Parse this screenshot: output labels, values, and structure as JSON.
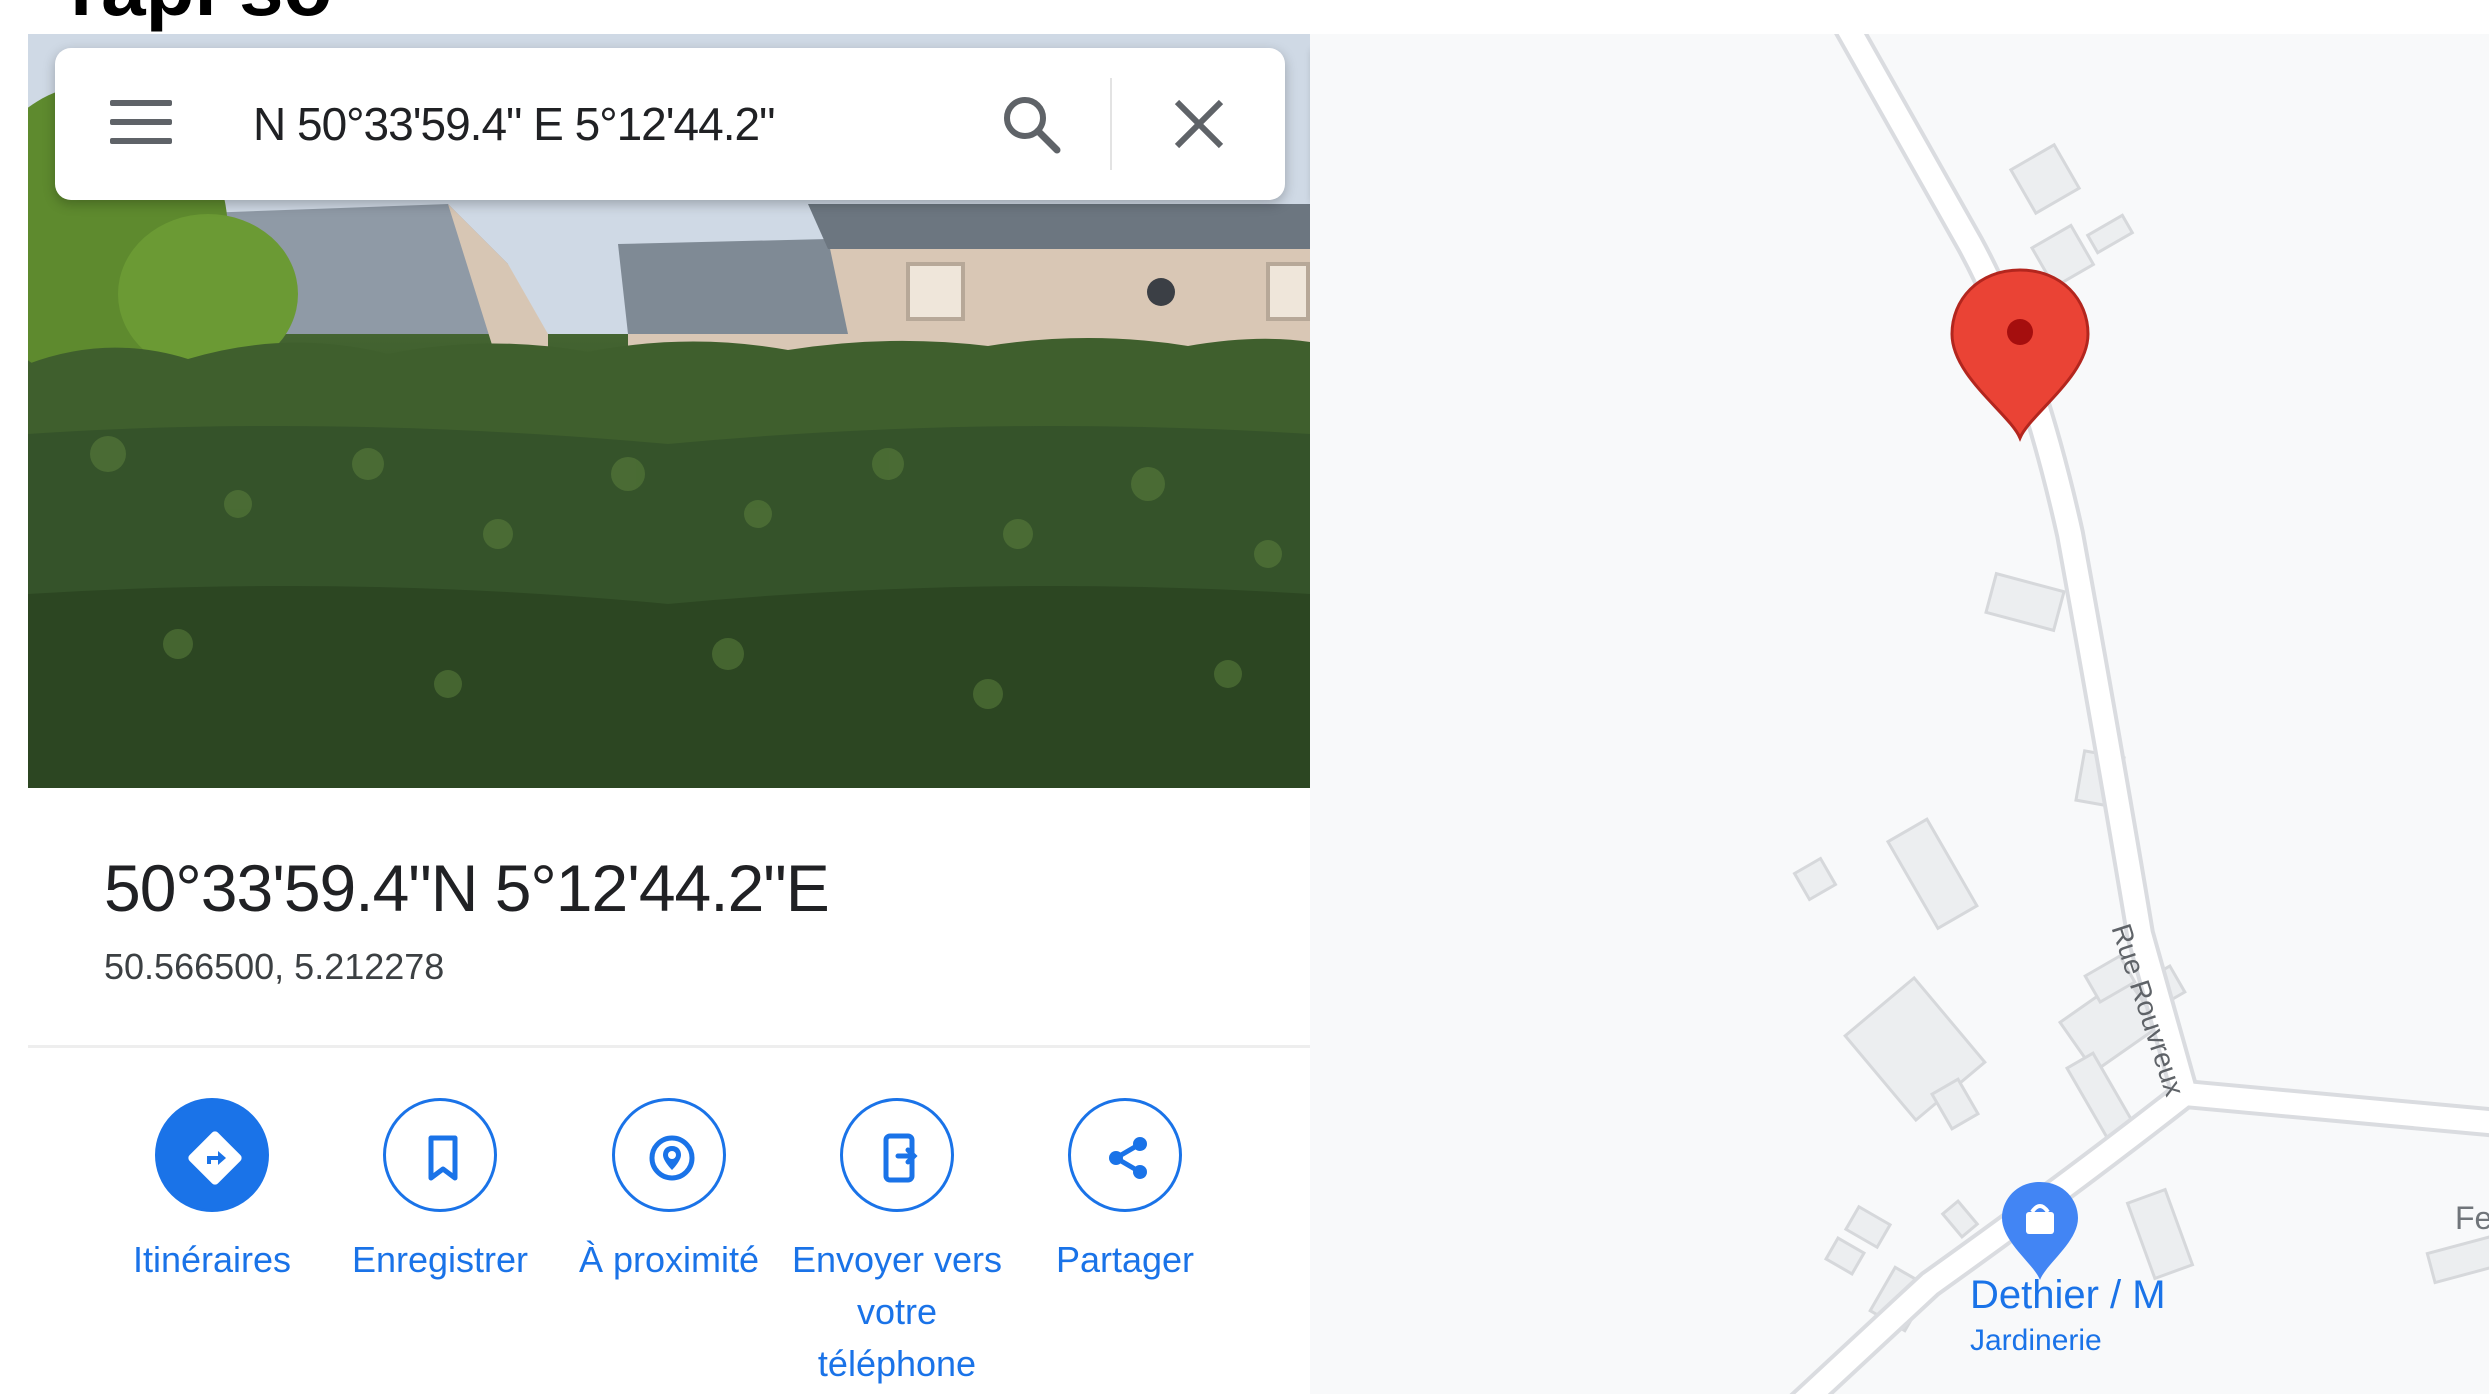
{
  "page": {
    "heading_fragment": "rapi so"
  },
  "search": {
    "value": "N 50°33'59.4\" E 5°12'44.2\""
  },
  "place": {
    "title": "50°33'59.4\"N 5°12'44.2\"E",
    "decimal": "50.566500, 5.212278"
  },
  "actions": [
    {
      "label": "Itinéraires",
      "icon": "directions-icon"
    },
    {
      "label": "Enregistrer",
      "icon": "bookmark-icon"
    },
    {
      "label": "À proximité",
      "icon": "nearby-icon"
    },
    {
      "label": "Envoyer vers votre téléphone",
      "icon": "send-to-phone-icon"
    },
    {
      "label": "Partager",
      "icon": "share-icon"
    }
  ],
  "map": {
    "street_label": "Rue Rouvreux",
    "poi": {
      "name": "Dethier / M",
      "category": "Jardinerie"
    },
    "edge_label": "Fe"
  },
  "colors": {
    "accent": "#1a73e8",
    "pin": "#ea4335",
    "map_bg": "#f8f9fa",
    "road": "#ffffff"
  }
}
